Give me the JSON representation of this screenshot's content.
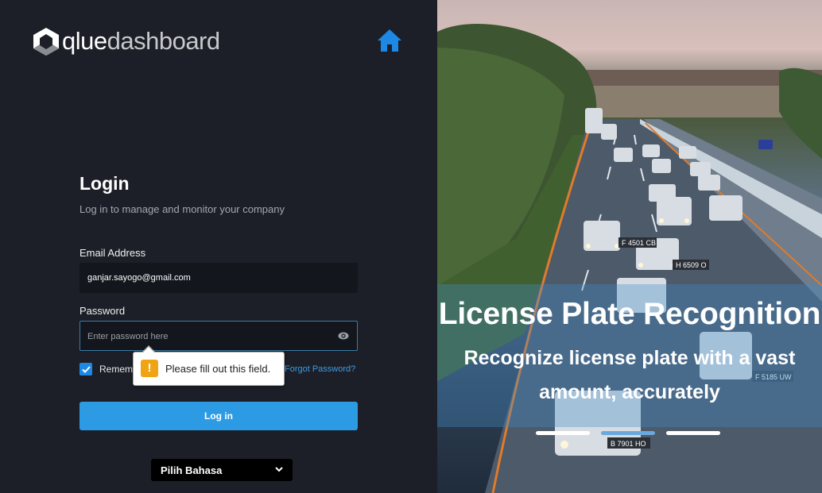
{
  "brand": {
    "name_part1": "qlue",
    "name_part2": "dashboard"
  },
  "login": {
    "title": "Login",
    "subtitle": "Log in to manage and monitor your company",
    "email_label": "Email Address",
    "email_value": "ganjar.sayogo@gmail.com",
    "password_label": "Password",
    "password_placeholder": "Enter password here",
    "remember_label": "Rememb",
    "remember_checked": true,
    "forgot_label": "Forgot Password?",
    "submit_label": "Log in",
    "validation_message": "Please fill out this field.",
    "warning_glyph": "!"
  },
  "language": {
    "label": "Pilih Bahasa"
  },
  "hero": {
    "title": "License Plate Recognition",
    "subtitle": "Recognize license plate with a vast amount, accurately",
    "slide_count": 3,
    "active_slide": 1,
    "plates": [
      "F 4501 CB",
      "H 6509 O",
      "B 7901 HO",
      "F 5185 UW"
    ]
  },
  "colors": {
    "panel_bg": "#1c1f27",
    "accent": "#2d9be3",
    "link": "#3f9ae6",
    "home_icon": "#1e88e5",
    "warning": "#f0a313"
  },
  "icons": [
    "logo-mark-icon",
    "home-icon",
    "eye-icon",
    "check-icon",
    "warning-icon",
    "chevron-down-icon"
  ]
}
